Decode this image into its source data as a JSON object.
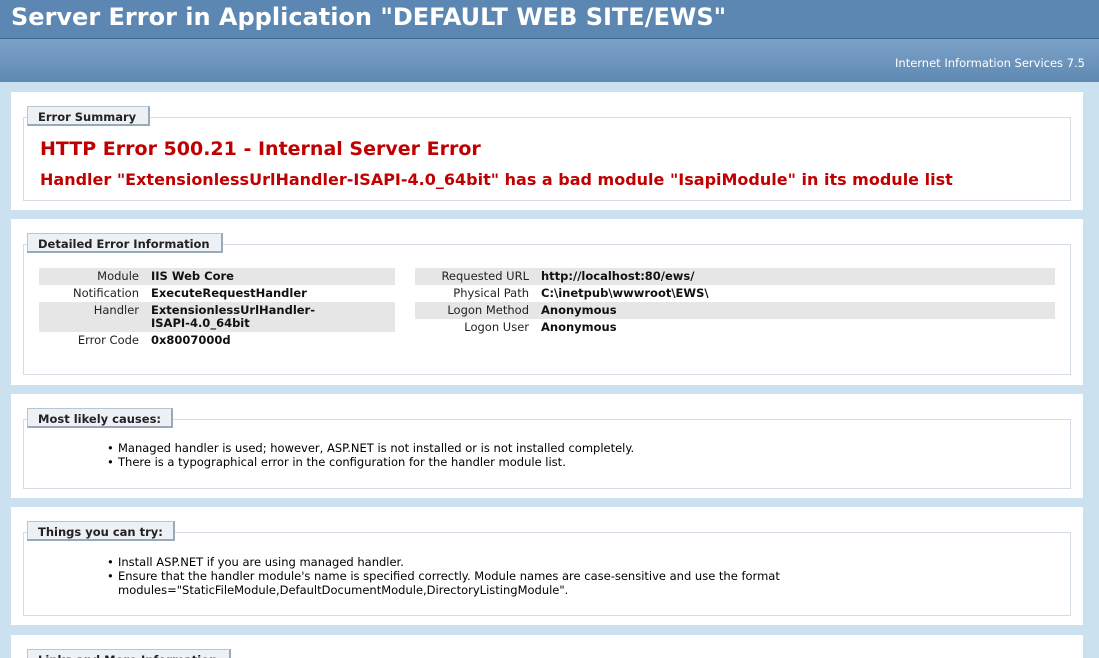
{
  "header": {
    "title": "Server Error in Application \"DEFAULT WEB SITE/EWS\"",
    "server": "Internet Information Services 7.5"
  },
  "summary": {
    "tab": "Error Summary",
    "title": "HTTP Error 500.21 - Internal Server Error",
    "message": "Handler \"ExtensionlessUrlHandler-ISAPI-4.0_64bit\" has a bad module \"IsapiModule\" in its module list"
  },
  "details": {
    "tab": "Detailed Error Information",
    "left": [
      {
        "key": "Module",
        "value": "IIS Web Core"
      },
      {
        "key": "Notification",
        "value": "ExecuteRequestHandler"
      },
      {
        "key": "Handler",
        "value": "ExtensionlessUrlHandler-\nISAPI-4.0_64bit"
      },
      {
        "key": "Error Code",
        "value": "0x8007000d"
      }
    ],
    "right": [
      {
        "key": "Requested URL",
        "value": "http://localhost:80/ews/"
      },
      {
        "key": "Physical Path",
        "value": "C:\\inetpub\\wwwroot\\EWS\\"
      },
      {
        "key": "Logon Method",
        "value": "Anonymous"
      },
      {
        "key": "Logon User",
        "value": "Anonymous"
      }
    ]
  },
  "causes": {
    "tab": "Most likely causes:",
    "items": [
      "Managed handler is used; however, ASP.NET is not installed or is not installed completely.",
      "There is a typographical error in the configuration for the handler module list."
    ]
  },
  "try": {
    "tab": "Things you can try:",
    "items": [
      "Install ASP.NET if you are using managed handler.",
      "Ensure that the handler module's name is specified correctly. Module names are case-sensitive and use the format modules=\"StaticFileModule,DefaultDocumentModule,DirectoryListingModule\"."
    ]
  },
  "links": {
    "tab": "Links and More Information"
  }
}
